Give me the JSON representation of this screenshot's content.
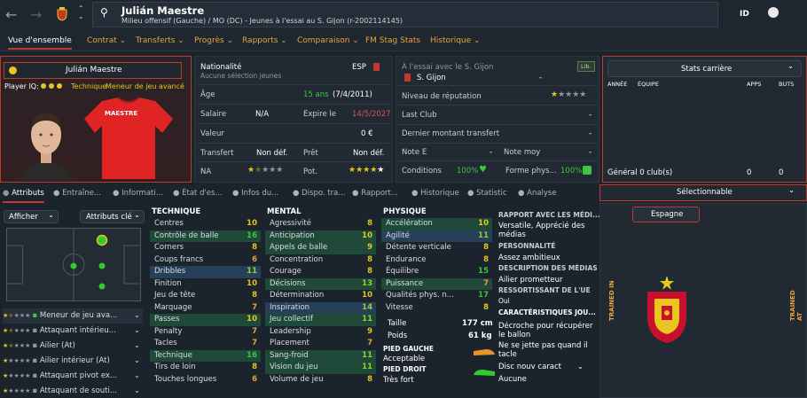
{
  "header": {
    "name": "Julián Maestre",
    "subtitle": "Milieu offensif (Gauche) / MO (DC) - Jeunes à l'essai au S. Gijon (r-2002114145)",
    "id_label": "ID"
  },
  "menu": [
    {
      "label": "Vue d'ensemble"
    },
    {
      "label": "Contrat ⌄"
    },
    {
      "label": "Transferts ⌄"
    },
    {
      "label": "Progrès ⌄"
    },
    {
      "label": "Rapports ⌄"
    },
    {
      "label": "Comparaison ⌄"
    },
    {
      "label": "FM Stag Stats"
    },
    {
      "label": "Historique ⌄"
    }
  ],
  "profile": {
    "name": "Julián Maestre",
    "player_iq_label": "Player IQ:",
    "iq_role": "Technique",
    "role": "Meneur de jeu avancé",
    "shirt_name": "MAESTRE"
  },
  "info": {
    "nat_label": "Nationalité",
    "nat_value": "ESP",
    "nat_sub": "Aucune sélection jeunes",
    "age_label": "Âge",
    "age_val": "15 ans",
    "age_date": "(7/4/2011)",
    "salary_label": "Salaire",
    "salary_val": "N/A",
    "expires_label": "Expire le",
    "expires_val": "14/5/2027",
    "value_label": "Valeur",
    "value_val": "0 €",
    "transfer_label": "Transfert",
    "transfer_val": "Non déf.",
    "loan_label": "Prêt",
    "loan_val": "Non déf.",
    "na_label": "NA",
    "pot_label": "Pot."
  },
  "club": {
    "trial_label": "À l'essai avec le S. Gijon",
    "club_name": "S. Gijon",
    "club_dash": "-",
    "badge": "Lib.",
    "rep_label": "Niveau de réputation",
    "last_club_label": "Last Club",
    "last_club_val": "-",
    "last_fee_label": "Dernier montant transfert",
    "last_fee_val": "-",
    "note_e_label": "Note E",
    "note_e_val": "-",
    "note_moy_label": "Note moy",
    "note_moy_val": "-",
    "cond_label": "Conditions",
    "cond_val": "100%",
    "form_label": "Forme phys...",
    "form_val": "100%"
  },
  "career": {
    "title": "Stats carrière",
    "col_year": "ANNÉE",
    "col_team": "ÉQUIPE",
    "col_apps": "APPS",
    "col_goals": "BUTS",
    "total_label": "Général 0 club(s)",
    "total_apps": "0",
    "total_goals": "0"
  },
  "tabs": [
    {
      "label": "Attributs"
    },
    {
      "label": "Entraîne..."
    },
    {
      "label": "Informati..."
    },
    {
      "label": "État d'es..."
    },
    {
      "label": "Infos du..."
    },
    {
      "label": "Dispo. tra..."
    },
    {
      "label": "Rapport..."
    },
    {
      "label": "Historique"
    },
    {
      "label": "Statistic"
    },
    {
      "label": "Analyse"
    }
  ],
  "controls": {
    "show_label": "Afficher",
    "attr_label": "Attributs clé"
  },
  "roles": [
    {
      "label": "Meneur de jeu ava..."
    },
    {
      "label": "Attaquant intérieu..."
    },
    {
      "label": "Ailier (At)"
    },
    {
      "label": "Ailier intérieur (At)"
    },
    {
      "label": "Attaquant pivot ex..."
    },
    {
      "label": "Attaquant de souti..."
    }
  ],
  "technique": {
    "title": "TECHNIQUE",
    "rows": [
      {
        "n": "Centres",
        "v": "10"
      },
      {
        "n": "Contrôle de balle",
        "v": "16"
      },
      {
        "n": "Corners",
        "v": "8"
      },
      {
        "n": "Coups francs",
        "v": "6"
      },
      {
        "n": "Dribbles",
        "v": "11"
      },
      {
        "n": "Finition",
        "v": "10"
      },
      {
        "n": "Jeu de tête",
        "v": "8"
      },
      {
        "n": "Marquage",
        "v": "7"
      },
      {
        "n": "Passes",
        "v": "10"
      },
      {
        "n": "Penalty",
        "v": "7"
      },
      {
        "n": "Tacles",
        "v": "7"
      },
      {
        "n": "Technique",
        "v": "16"
      },
      {
        "n": "Tirs de loin",
        "v": "8"
      },
      {
        "n": "Touches longues",
        "v": "6"
      }
    ]
  },
  "mental": {
    "title": "MENTAL",
    "rows": [
      {
        "n": "Agressivité",
        "v": "8"
      },
      {
        "n": "Anticipation",
        "v": "10"
      },
      {
        "n": "Appels de balle",
        "v": "9"
      },
      {
        "n": "Concentration",
        "v": "8"
      },
      {
        "n": "Courage",
        "v": "8"
      },
      {
        "n": "Décisions",
        "v": "13"
      },
      {
        "n": "Détermination",
        "v": "10"
      },
      {
        "n": "Inspiration",
        "v": "14"
      },
      {
        "n": "Jeu collectif",
        "v": "11"
      },
      {
        "n": "Leadership",
        "v": "9"
      },
      {
        "n": "Placement",
        "v": "7"
      },
      {
        "n": "Sang-froid",
        "v": "11"
      },
      {
        "n": "Vision du jeu",
        "v": "11"
      },
      {
        "n": "Volume de jeu",
        "v": "8"
      }
    ]
  },
  "physique": {
    "title": "PHYSIQUE",
    "rows": [
      {
        "n": "Accélération",
        "v": "10"
      },
      {
        "n": "Agilité",
        "v": "11"
      },
      {
        "n": "Détente verticale",
        "v": "8"
      },
      {
        "n": "Endurance",
        "v": "8"
      },
      {
        "n": "Équilibre",
        "v": "15"
      },
      {
        "n": "Puissance",
        "v": "7"
      },
      {
        "n": "Qualités phys. n...",
        "v": "17"
      },
      {
        "n": "Vitesse",
        "v": "8"
      }
    ]
  },
  "body": {
    "height_label": "Taille",
    "height_val": "177 cm",
    "weight_label": "Poids",
    "weight_val": "61 kg",
    "left_foot_label": "PIED GAUCHE",
    "left_foot_val": "Acceptable",
    "right_foot_label": "PIED DROIT",
    "right_foot_val": "Très fort"
  },
  "report": {
    "t1": "RAPPORT AVEC LES MÉDI...",
    "v1": "Versatile, Apprécié des médias",
    "t2": "PERSONNALITÉ",
    "v2": "Assez ambitieux",
    "t3": "DESCRIPTION DES MÉDIAS",
    "v3": "Ailier prometteur",
    "t4": "RESSORTISSANT DE L'UE",
    "v4": "Oui",
    "t5": "CARACTÉRISTIQUES JOU...",
    "v5a": "Décroche pour récupérer le ballon",
    "v5b": "Ne se jette pas quand il tacle",
    "v5c": "Disc nouv caract",
    "v5d": "Aucune"
  },
  "selection": {
    "title": "Sélectionnable",
    "country": "Espagne",
    "trained_in": "TRAINED IN",
    "trained_at": "TRAINED AT"
  },
  "colors": {
    "accent": "#c0392b",
    "menu": "#e8a33d",
    "green": "#3ec43e",
    "yellow": "#e8c51f"
  }
}
